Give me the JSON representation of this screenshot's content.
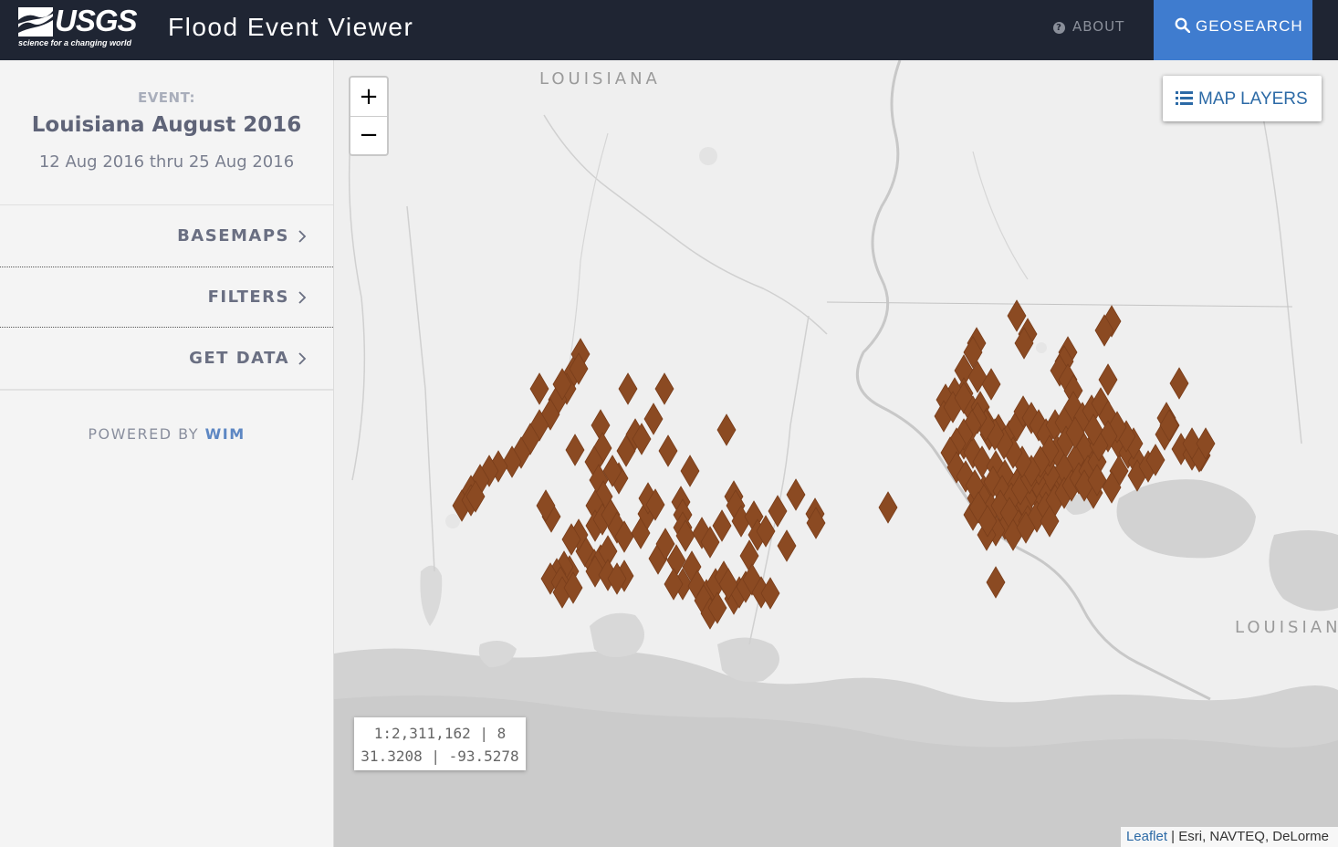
{
  "header": {
    "logo_text": "USGS",
    "logo_tagline": "science for a changing world",
    "app_title": "Flood Event Viewer",
    "about_label": "ABOUT",
    "about_icon": "question-circle-icon",
    "geosearch_label": "GEOSEARCH",
    "geosearch_icon": "search-icon",
    "colors": {
      "bar": "#1f2533",
      "geosearch": "#3f7ccf"
    }
  },
  "sidebar": {
    "event_label": "EVENT:",
    "event_name": "Louisiana August 2016",
    "event_dates": "12 Aug 2016 thru 25 Aug 2016",
    "menu": [
      {
        "label": "BASEMAPS",
        "icon": "chevron-right-icon"
      },
      {
        "label": "FILTERS",
        "icon": "chevron-right-icon"
      },
      {
        "label": "GET DATA",
        "icon": "chevron-right-icon"
      }
    ],
    "powered_prefix": "POWERED BY",
    "powered_brand": "WIM"
  },
  "map": {
    "zoom_in": "+",
    "zoom_out": "−",
    "layers_label": "MAP LAYERS",
    "layers_icon": "list-icon",
    "scale_line": "1:2,311,162 | 8",
    "coords_line": "31.3208 | -93.5278",
    "attribution_link": "Leaflet",
    "attribution_text": "| Esri, NAVTEQ, DeLorme",
    "labels": [
      "LOUISIANA",
      "LOUISIAN"
    ],
    "marker_color": "#8b4a22",
    "marker_shape": "diamond"
  }
}
